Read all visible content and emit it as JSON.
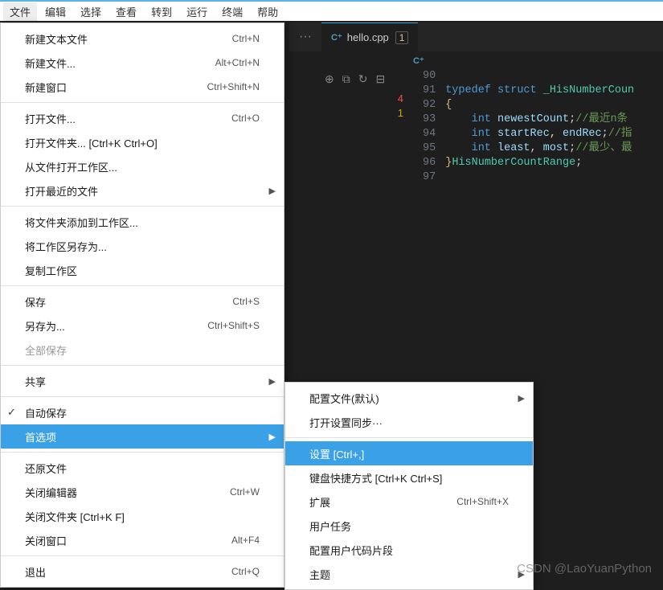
{
  "menubar": {
    "items": [
      "文件",
      "编辑",
      "选择",
      "查看",
      "转到",
      "运行",
      "终端",
      "帮助"
    ]
  },
  "tab": {
    "overflow": "···",
    "icon": "C⁺",
    "name": "hello.cpp",
    "modified": "1"
  },
  "breadcrumb": {
    "icon": "C⁺"
  },
  "explorer_icons": [
    "⊕",
    "⧉",
    "↻",
    "⊟"
  ],
  "gutter_left": {
    "err": "4",
    "warn": "1"
  },
  "editor": {
    "lines": [
      {
        "n": "90",
        "segs": []
      },
      {
        "n": "91",
        "segs": [
          [
            "kw",
            "typedef "
          ],
          [
            "kw",
            "struct "
          ],
          [
            "ty",
            "_HisNumberCoun"
          ]
        ]
      },
      {
        "n": "92",
        "segs": [
          [
            "ye",
            "{"
          ]
        ]
      },
      {
        "n": "93",
        "segs": [
          [
            "pn",
            "    "
          ],
          [
            "kw",
            "int "
          ],
          [
            "id",
            "newestCount"
          ],
          [
            "pn",
            ";"
          ],
          [
            "cm",
            "//最近n条"
          ]
        ]
      },
      {
        "n": "94",
        "segs": [
          [
            "pn",
            "    "
          ],
          [
            "kw",
            "int "
          ],
          [
            "id",
            "startRec"
          ],
          [
            "pn",
            ", "
          ],
          [
            "id",
            "endRec"
          ],
          [
            "pn",
            ";"
          ],
          [
            "cm",
            "//指"
          ]
        ]
      },
      {
        "n": "95",
        "segs": [
          [
            "pn",
            "    "
          ],
          [
            "kw",
            "int "
          ],
          [
            "id",
            "least"
          ],
          [
            "pn",
            ", "
          ],
          [
            "id",
            "most"
          ],
          [
            "pn",
            ";"
          ],
          [
            "cm",
            "//最少、最"
          ]
        ]
      },
      {
        "n": "96",
        "segs": [
          [
            "ye",
            "}"
          ],
          [
            "ty",
            "HisNumberCountRange"
          ],
          [
            "pn",
            ";"
          ]
        ]
      },
      {
        "n": "97",
        "segs": []
      }
    ]
  },
  "file_menu": {
    "groups": [
      [
        {
          "label": "新建文本文件",
          "shortcut": "Ctrl+N"
        },
        {
          "label": "新建文件...",
          "shortcut": "Alt+Ctrl+N"
        },
        {
          "label": "新建窗口",
          "shortcut": "Ctrl+Shift+N"
        }
      ],
      [
        {
          "label": "打开文件...",
          "shortcut": "Ctrl+O"
        },
        {
          "label": "打开文件夹... [Ctrl+K Ctrl+O]"
        },
        {
          "label": "从文件打开工作区..."
        },
        {
          "label": "打开最近的文件",
          "sub": true
        }
      ],
      [
        {
          "label": "将文件夹添加到工作区..."
        },
        {
          "label": "将工作区另存为..."
        },
        {
          "label": "复制工作区"
        }
      ],
      [
        {
          "label": "保存",
          "shortcut": "Ctrl+S"
        },
        {
          "label": "另存为...",
          "shortcut": "Ctrl+Shift+S"
        },
        {
          "label": "全部保存",
          "disabled": true
        }
      ],
      [
        {
          "label": "共享",
          "sub": true
        }
      ],
      [
        {
          "label": "自动保存",
          "checked": true
        },
        {
          "label": "首选项",
          "sub": true,
          "highlight": true
        }
      ],
      [
        {
          "label": "还原文件"
        },
        {
          "label": "关闭编辑器",
          "shortcut": "Ctrl+W"
        },
        {
          "label": "关闭文件夹 [Ctrl+K F]"
        },
        {
          "label": "关闭窗口",
          "shortcut": "Alt+F4"
        }
      ],
      [
        {
          "label": "退出",
          "shortcut": "Ctrl+Q"
        }
      ]
    ]
  },
  "submenu": {
    "groups": [
      [
        {
          "label": "配置文件(默认)",
          "sub": true
        },
        {
          "label": "打开设置同步···"
        }
      ],
      [
        {
          "label": "设置 [Ctrl+,]",
          "highlight": true
        },
        {
          "label": "键盘快捷方式 [Ctrl+K Ctrl+S]"
        },
        {
          "label": "扩展",
          "shortcut": "Ctrl+Shift+X"
        },
        {
          "label": "用户任务"
        },
        {
          "label": "配置用户代码片段"
        },
        {
          "label": "主题",
          "sub": true
        }
      ]
    ]
  },
  "watermark": "CSDN @LaoYuanPython"
}
